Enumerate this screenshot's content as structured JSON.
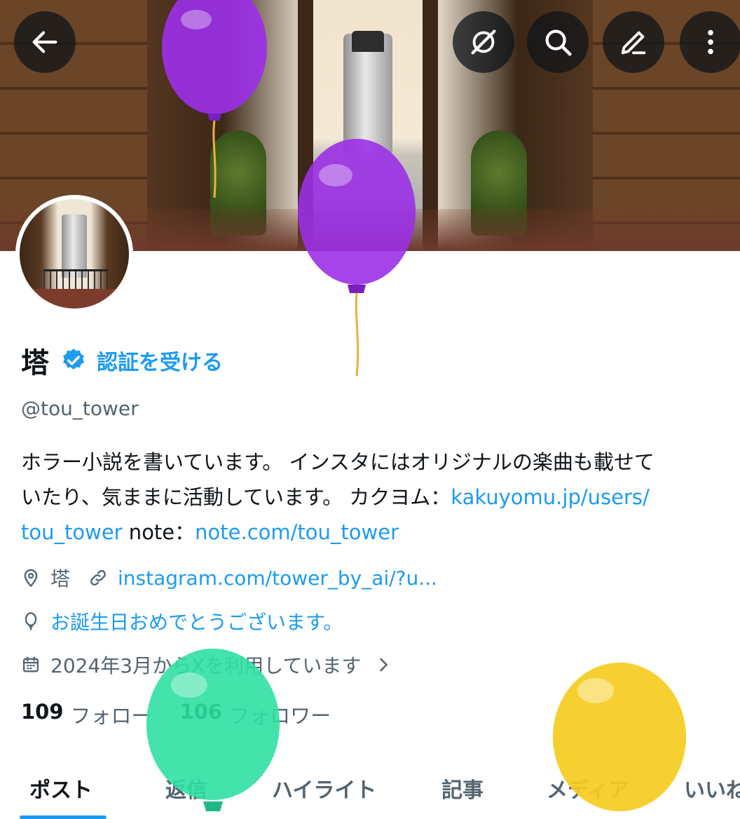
{
  "profile": {
    "display_name": "塔",
    "get_verified_label": "認証を受ける",
    "handle": "@tou_tower",
    "bio": {
      "line1": "ホラー小説を書いています。 インスタにはオリジナルの楽曲も載せて",
      "line2_text": "いたり、気ままに活動しています。 カクヨム：",
      "line2_link": "kakuyomu.jp/users/",
      "line3_link1": "tou_tower",
      "line3_text": " note：",
      "line3_link2": "note.com/tou_tower"
    },
    "location": "塔",
    "website": "instagram.com/tower_by_ai/?u...",
    "birthday_message": "お誕生日おめでとうございます。",
    "joined": "2024年3月からXを利用しています"
  },
  "stats": {
    "following_count": "109",
    "following_label": "フォロー",
    "followers_count": "106",
    "followers_label": "フォロワー"
  },
  "tabs": [
    {
      "label": "ポスト",
      "active": true
    },
    {
      "label": "返信",
      "active": false
    },
    {
      "label": "ハイライト",
      "active": false
    },
    {
      "label": "記事",
      "active": false
    },
    {
      "label": "メディア",
      "active": false
    },
    {
      "label": "いいね",
      "active": false
    }
  ],
  "icons": {
    "back": "arrow-left-icon",
    "grok": "grok-icon",
    "search": "search-icon",
    "edit": "pencil-icon",
    "more": "more-vertical-icon",
    "verified": "verified-badge-icon",
    "location": "location-pin-icon",
    "link": "link-icon",
    "birthday": "balloon-icon",
    "calendar": "calendar-icon",
    "chevron": "chevron-right-icon"
  },
  "colors": {
    "accent": "#1d9bf0",
    "text_primary": "#0f1419",
    "text_secondary": "#536471",
    "balloon_purple": "#9b30e6",
    "balloon_green": "#2fe0a2",
    "balloon_yellow": "#f5cc1f"
  }
}
